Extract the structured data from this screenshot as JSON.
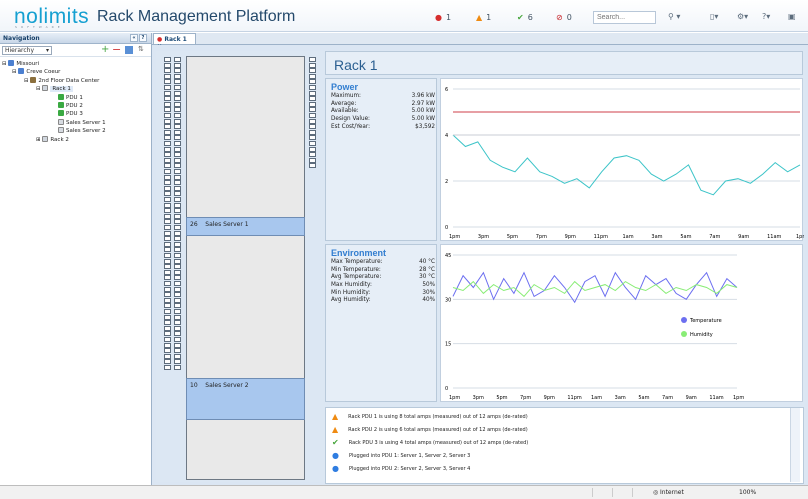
{
  "app": {
    "logo": "nolimits",
    "logo_sub": "SOFTWARE",
    "title": "Rack Management Platform",
    "alerts": [
      {
        "icon": "error-icon",
        "count": "1",
        "color": "#d62e2e"
      },
      {
        "icon": "warning-icon",
        "count": "1",
        "color": "#ef8b12"
      },
      {
        "icon": "check-icon",
        "count": "6",
        "color": "#48a63d"
      },
      {
        "icon": "blocked-icon",
        "count": "0",
        "color": "#c8282d"
      }
    ],
    "search_placeholder": "Search...",
    "tool_icons": [
      "search-icon",
      "document-icon",
      "gear-icon",
      "help-icon",
      "user-icon"
    ]
  },
  "navigation": {
    "title": "Navigation",
    "view": "Hierarchy",
    "tree": [
      {
        "label": "Missouri",
        "level": 0,
        "icon": "location-icon"
      },
      {
        "label": "Creve Coeur",
        "level": 1,
        "icon": "location-icon"
      },
      {
        "label": "2nd Floor Data Center",
        "level": 2,
        "icon": "building-icon"
      },
      {
        "label": "Rack 1",
        "level": 3,
        "icon": "rack-icon",
        "selected": true
      },
      {
        "label": "PDU 1",
        "level": 4,
        "icon": "pdu-icon"
      },
      {
        "label": "PDU 2",
        "level": 4,
        "icon": "pdu-icon"
      },
      {
        "label": "PDU 3",
        "level": 4,
        "icon": "pdu-icon"
      },
      {
        "label": "Sales Server 1",
        "level": 4,
        "icon": "server-icon"
      },
      {
        "label": "Sales Server 2",
        "level": 4,
        "icon": "server-icon"
      },
      {
        "label": "Rack 2",
        "level": 3,
        "icon": "rack-icon"
      }
    ]
  },
  "tab": {
    "label": "Rack 1"
  },
  "rack": {
    "title": "Rack 1",
    "slots": [
      {
        "unit": "26",
        "name": "Sales Server 1"
      },
      {
        "unit": "10",
        "name": "Sales Server 2"
      }
    ]
  },
  "power": {
    "title": "Power",
    "metrics": [
      {
        "label": "Maximum:",
        "value": "3.96 kW"
      },
      {
        "label": "Average:",
        "value": "2.97 kW"
      },
      {
        "label": "Available:",
        "value": "5.00 kW"
      },
      {
        "label": "Design Value:",
        "value": "5.00 kW"
      },
      {
        "label": "Est Cost/Year:",
        "value": "$3,592"
      }
    ]
  },
  "environment": {
    "title": "Environment",
    "metrics": [
      {
        "label": "Max Temperature:",
        "value": "40 °C"
      },
      {
        "label": "Min Temperature:",
        "value": "28 °C"
      },
      {
        "label": "Avg Temperature:",
        "value": "30 °C"
      },
      {
        "label": "Max Humidity:",
        "value": "50%"
      },
      {
        "label": "Min Humidity:",
        "value": "30%"
      },
      {
        "label": "Avg Humidity:",
        "value": "40%"
      }
    ]
  },
  "chart_data": [
    {
      "type": "line",
      "x": [
        "1pm",
        "3pm",
        "5pm",
        "7pm",
        "9pm",
        "11pm",
        "1am",
        "3am",
        "5am",
        "7am",
        "9am",
        "11am",
        "1pm"
      ],
      "ylim": [
        0,
        6
      ],
      "yticks": [
        "0",
        "2",
        "4",
        "6"
      ],
      "series": [
        {
          "color": "#3cc4c8",
          "values": [
            4.0,
            3.5,
            3.7,
            2.9,
            2.6,
            2.4,
            3.0,
            2.4,
            2.2,
            1.9,
            2.1,
            1.7,
            2.4,
            3.0,
            3.1,
            2.9,
            2.3,
            2.0,
            2.3,
            2.7,
            1.6,
            1.4,
            2.0,
            2.1,
            1.9,
            2.3,
            2.8,
            2.4,
            2.7
          ]
        },
        {
          "color": "#cf3f48",
          "values": [
            5.0,
            5.0,
            5.0,
            5.0,
            5.0,
            5.0,
            5.0,
            5.0,
            5.0,
            5.0,
            5.0,
            5.0,
            5.0,
            5.0,
            5.0,
            5.0,
            5.0,
            5.0,
            5.0,
            5.0,
            5.0,
            5.0,
            5.0,
            5.0,
            5.0,
            5.0,
            5.0,
            5.0,
            5.0
          ]
        },
        {
          "color": "#c8ced5",
          "values": [
            4.0,
            4.0,
            4.0,
            4.0,
            4.0,
            4.0,
            4.0,
            4.0,
            4.0,
            4.0,
            4.0,
            4.0,
            4.0,
            4.0,
            4.0,
            4.0,
            4.0,
            4.0,
            4.0,
            4.0,
            4.0,
            4.0,
            4.0,
            4.0,
            4.0,
            4.0,
            4.0,
            4.0,
            4.0
          ]
        }
      ]
    },
    {
      "type": "line",
      "x": [
        "1pm",
        "3pm",
        "5pm",
        "7pm",
        "9pm",
        "11pm",
        "1am",
        "3am",
        "5am",
        "7am",
        "9am",
        "11am",
        "1pm"
      ],
      "ylim": [
        0,
        45
      ],
      "yticks": [
        "0",
        "15",
        "30",
        "45"
      ],
      "series": [
        {
          "name": "Temperature",
          "color": "#6c6ff0",
          "values": [
            31,
            38,
            34,
            39,
            30,
            37,
            32,
            39,
            31,
            33,
            38,
            34,
            29,
            36,
            38,
            31,
            39,
            34,
            30,
            38,
            35,
            37,
            32,
            30,
            35,
            39,
            31,
            37,
            34
          ]
        },
        {
          "name": "Humidity",
          "color": "#89ed76",
          "values": [
            34,
            33,
            36,
            32,
            35,
            33,
            34,
            31,
            35,
            33,
            34,
            32,
            36,
            33,
            34,
            35,
            33,
            36,
            34,
            33,
            35,
            32,
            34,
            33,
            35,
            34,
            32,
            35,
            34
          ]
        }
      ]
    }
  ],
  "alerts": [
    {
      "icon": "warning-icon",
      "text": "Rack PDU 1 is using 8 total amps (measured) out of 12 amps (de-rated)"
    },
    {
      "icon": "warning-icon",
      "text": "Rack PDU 2 is using 6 total amps (measured) out of 12 amps (de-rated)"
    },
    {
      "icon": "check-icon",
      "text": "Rack PDU 3 is using 4 total amps (measured) out of 12 amps (de-rated)"
    },
    {
      "icon": "info-icon",
      "text": "Plugged into PDU 1: Server 1, Server 2, Server 3"
    },
    {
      "icon": "info-icon",
      "text": "Plugged into PDU 2: Server 2, Server 3, Server 4"
    }
  ],
  "statusbar": {
    "zone": "Internet",
    "zoom": "100%"
  }
}
